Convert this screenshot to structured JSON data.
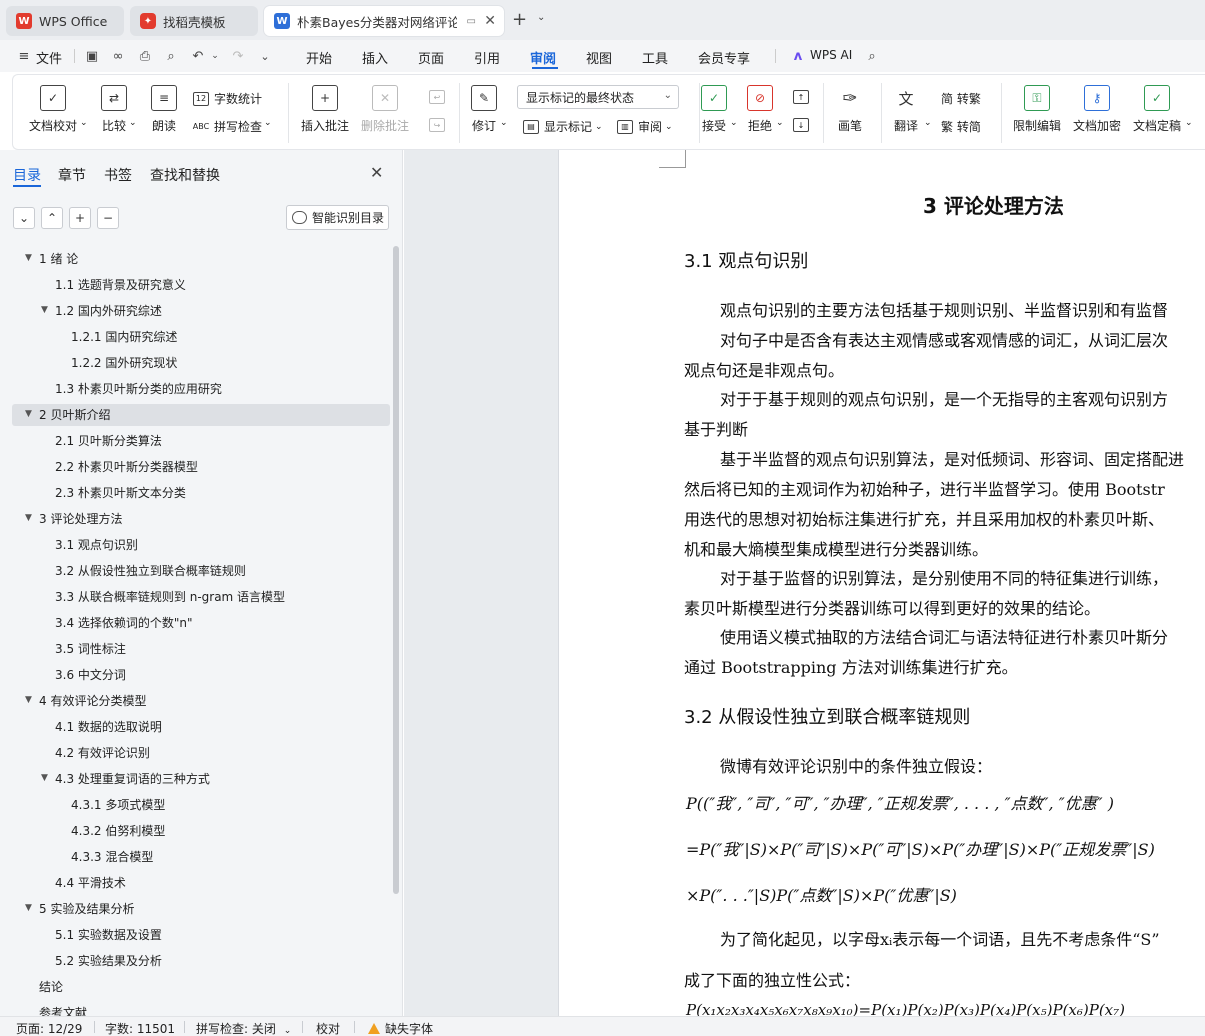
{
  "tabs": [
    {
      "label": "WPS Office",
      "icon": "wps-logo-icon"
    },
    {
      "label": "找稻壳模板",
      "icon": "docer-icon"
    },
    {
      "label": "朴素Bayes分类器对网络评论有",
      "icon": "writer-doc-icon"
    }
  ],
  "menu": {
    "file": "文件",
    "items": [
      "开始",
      "插入",
      "页面",
      "引用",
      "审阅",
      "视图",
      "工具",
      "会员专享"
    ],
    "active": "审阅",
    "ai": "WPS AI"
  },
  "ribbon": {
    "doc_check": "文档校对",
    "compare": "比较",
    "read_aloud": "朗读",
    "word_count": "字数统计",
    "spell_check": "拼写检查",
    "insert_comment": "插入批注",
    "delete_comment": "删除批注",
    "track": "修订",
    "markup_mode": "显示标记的最终状态",
    "show_markup": "显示标记",
    "review_pane": "审阅",
    "accept": "接受",
    "reject": "拒绝",
    "pen": "画笔",
    "translate": "翻译",
    "to_traditional": "简 转繁",
    "to_simplified": "繁 转简",
    "restrict_edit": "限制编辑",
    "encrypt": "文档加密",
    "finalize": "文档定稿"
  },
  "sidebar": {
    "tabs": [
      "目录",
      "章节",
      "书签",
      "查找和替换"
    ],
    "active_tab": "目录",
    "smart_toc": "智能识别目录",
    "toc": [
      {
        "text": "1  绪  论",
        "level": 1,
        "expanded": true
      },
      {
        "text": "1.1 选题背景及研究意义",
        "level": 2
      },
      {
        "text": "1.2 国内外研究综述",
        "level": 2,
        "expanded": true
      },
      {
        "text": "1.2.1 国内研究综述",
        "level": 3
      },
      {
        "text": "1.2.2 国外研究现状",
        "level": 3
      },
      {
        "text": "1.3 朴素贝叶斯分类的应用研究",
        "level": 2
      },
      {
        "text": "2  贝叶斯介绍",
        "level": 1,
        "expanded": true,
        "selected": true
      },
      {
        "text": "2.1 贝叶斯分类算法",
        "level": 2
      },
      {
        "text": "2.2 朴素贝叶斯分类器模型",
        "level": 2
      },
      {
        "text": "2.3 朴素贝叶斯文本分类",
        "level": 2
      },
      {
        "text": "3  评论处理方法",
        "level": 1,
        "expanded": true
      },
      {
        "text": "3.1 观点句识别",
        "level": 2
      },
      {
        "text": "3.2 从假设性独立到联合概率链规则",
        "level": 2
      },
      {
        "text": "3.3 从联合概率链规则到 n-gram 语言模型",
        "level": 2
      },
      {
        "text": "3.4 选择依赖词的个数\"n\"",
        "level": 2
      },
      {
        "text": "3.5 词性标注",
        "level": 2
      },
      {
        "text": "3.6 中文分词",
        "level": 2
      },
      {
        "text": "4  有效评论分类模型",
        "level": 1,
        "expanded": true
      },
      {
        "text": "4.1 数据的选取说明",
        "level": 2
      },
      {
        "text": "4.2 有效评论识别",
        "level": 2
      },
      {
        "text": "4.3 处理重复词语的三种方式",
        "level": 2,
        "expanded": true
      },
      {
        "text": "4.3.1 多项式模型",
        "level": 3
      },
      {
        "text": "4.3.2 伯努利模型",
        "level": 3
      },
      {
        "text": "4.3.3 混合模型",
        "level": 3
      },
      {
        "text": "4.4 平滑技术",
        "level": 2
      },
      {
        "text": "5  实验及结果分析",
        "level": 1,
        "expanded": true
      },
      {
        "text": "5.1 实验数据及设置",
        "level": 2
      },
      {
        "text": "5.2 实验结果及分析",
        "level": 2
      },
      {
        "text": "结论",
        "level": 1
      },
      {
        "text": "参考文献",
        "level": 1
      }
    ]
  },
  "document": {
    "chapter_title": "3  评论处理方法",
    "sec1_title": "3.1 观点句识别",
    "p1": "观点句识别的主要方法包括基于规则识别、半监督识别和有监督",
    "p2a": "对句子中是否含有表达主观情感或客观情感的词汇，从词汇层次",
    "p2b": "观点句还是非观点句。",
    "p3a": "对于于基于规则的观点句识别，是一个无指导的主客观句识别方",
    "p3b": "基于判断",
    "p4a": "基于半监督的观点句识别算法，是对低频词、形容词、固定搭配进",
    "p4b": "然后将已知的主观词作为初始种子，进行半监督学习。使用 Bootstr",
    "p4c": "用迭代的思想对初始标注集进行扩充，并且采用加权的朴素贝叶斯、",
    "p4d": "机和最大熵模型集成模型进行分类器训练。",
    "p5a": "对于基于监督的识别算法，是分别使用不同的特征集进行训练，",
    "p5b": "素贝叶斯模型进行分类器训练可以得到更好的效果的结论。",
    "p6a": "使用语义模式抽取的方法结合词汇与语法特征进行朴素贝叶斯分",
    "p6b": "通过 Bootstrapping 方法对训练集进行扩充。",
    "sec2_title": "3.2 从假设性独立到联合概率链规则",
    "p7": "微博有效评论识别中的条件独立假设：",
    "f1": "P((″我″, ″司″, ″可″, ″办理″, ″正规发票″, . . . , ″点数″, ″优惠″ )",
    "f2": "=P(″我″|S)×P(″司″|S)×P(″可″|S)×P(″办理″|S)×P(″正规发票″|S)",
    "f3": "×P(″. . .″|S)P(″点数″|S)×P(″优惠″|S)",
    "p8a": "为了简化起见，以字母xᵢ表示每一个词语，且先不考虑条件“S”",
    "p8b": "成了下面的独立性公式：",
    "f4": "P(x₁x₂x₃x₄x₅x₆x₇x₈x₉x₁₀)=P(x₁)P(x₂)P(x₃)P(x₄)P(x₅)P(x₆)P(x₇)"
  },
  "status": {
    "page": "页面: 12/29",
    "words": "字数: 11501",
    "spell": "拼写检查: 关闭",
    "proof": "校对",
    "missing_font": "缺失字体"
  },
  "colors": {
    "accent": "#1a66d9",
    "warning": "#f0a020",
    "wps_red": "#e23b2e"
  }
}
